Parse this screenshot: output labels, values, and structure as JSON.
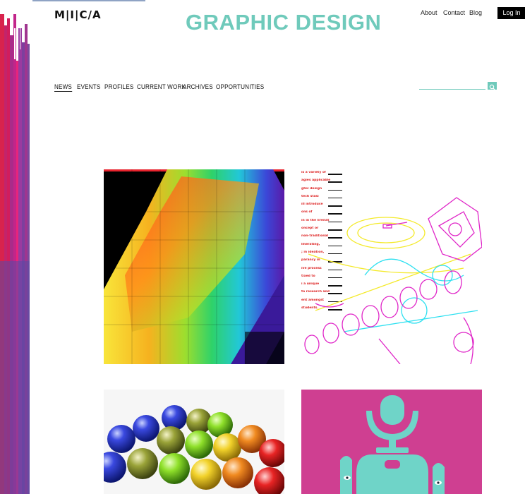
{
  "header": {
    "logo": "M|I|C/A",
    "site_title": "GRAPHIC DESIGN",
    "util_links": [
      "About",
      "Contact",
      "Blog"
    ],
    "login_label": "Log In"
  },
  "nav": {
    "items": [
      "NEWS",
      "EVENTS",
      "PROFILES",
      "CURRENT WORK",
      "ARCHIVES",
      "OPPORTUNITIES"
    ],
    "active": "NEWS"
  },
  "search": {
    "placeholder": ""
  },
  "feature_text_lines": [
    "is a variety of",
    "agies applicable",
    "ghic design",
    "tech stasi",
    "ill introduce",
    "ons of",
    "in in the lirenat",
    "oncept or",
    "non-traditional",
    "lmerating,",
    "; in ideation,",
    "parancy in",
    "ive process",
    "tixed to",
    "i a unique",
    "to research and",
    "ent amongst",
    "students."
  ],
  "colors": {
    "accent": "#6fcabb",
    "magenta_tile": "#cf3f91"
  }
}
